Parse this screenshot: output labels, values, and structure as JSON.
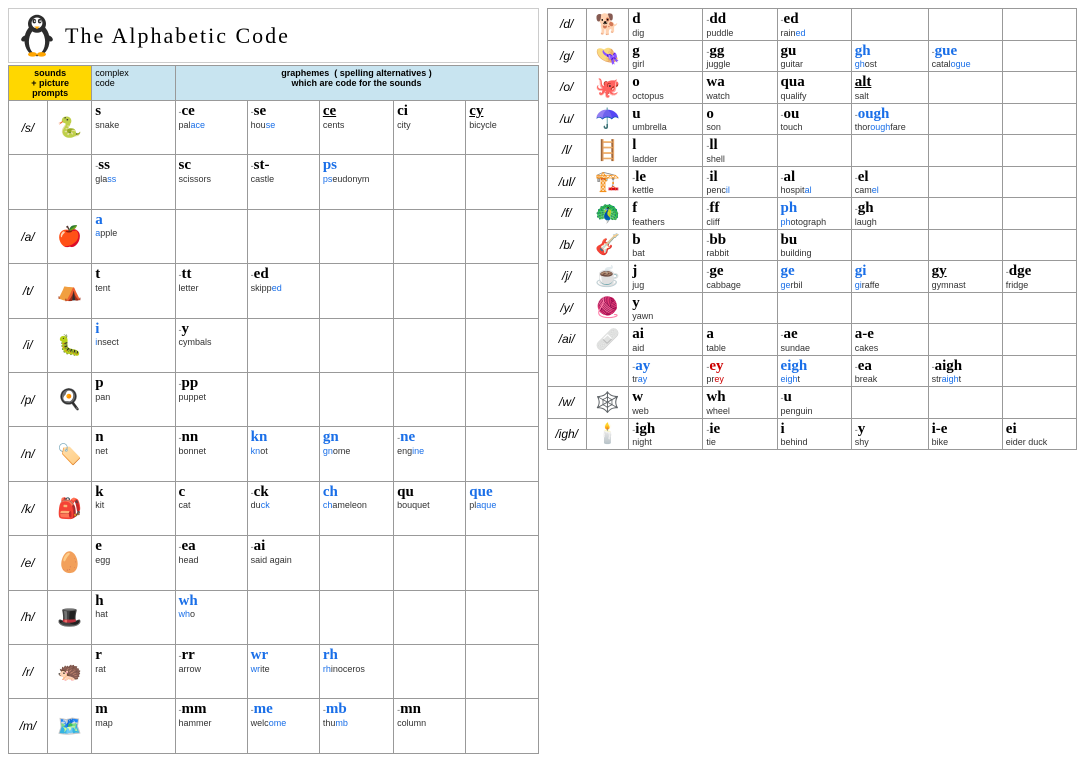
{
  "title": "The Alphabetic Code",
  "header": {
    "col1": "sounds\n+ picture\nprompts",
    "col2": "complex\ncode",
    "col3": "graphemes  ( spelling alternatives )\nwhich are code for the sounds"
  },
  "left_rows": [
    {
      "sound": "/s/",
      "emoji": "🐍",
      "cells": [
        {
          "pre": "",
          "g": "s",
          "word": "snake",
          "hl": ""
        },
        {
          "pre": "-",
          "g": "ce",
          "word": "pal<ace",
          "hl": "ace"
        },
        {
          "pre": "-",
          "g": "se",
          "word": "hou<se",
          "hl": "se"
        },
        {
          "pre": "",
          "g": "ce",
          "word": "cents",
          "hl": "",
          "style": "underline"
        },
        {
          "pre": "",
          "g": "ci",
          "word": "city",
          "hl": ""
        },
        {
          "pre": "",
          "g": "cy",
          "word": "bicycle",
          "hl": "",
          "style": "underline"
        }
      ],
      "row2": [
        {
          "pre": "-",
          "g": "ss",
          "word": "gla<ss",
          "hl": "ss"
        },
        {
          "pre": "",
          "g": "sc",
          "word": "scissors",
          "hl": ""
        },
        {
          "pre": "-",
          "g": "st-",
          "word": "castle",
          "hl": ""
        },
        {
          "pre": "",
          "g": "ps",
          "word": "pseudonym",
          "hl": "ps",
          "blue": true
        }
      ]
    },
    {
      "sound": "/a/",
      "emoji": "🍎",
      "cells": [
        {
          "pre": "",
          "g": "a",
          "word": "apple",
          "hl": "a",
          "blue": true
        }
      ]
    },
    {
      "sound": "/t/",
      "emoji": "⛺",
      "cells": [
        {
          "pre": "",
          "g": "t",
          "word": "tent",
          "hl": ""
        },
        {
          "pre": "-",
          "g": "tt",
          "word": "letter",
          "hl": ""
        },
        {
          "pre": "-",
          "g": "ed",
          "word": "skipp<ed",
          "hl": "ed"
        }
      ]
    },
    {
      "sound": "/i/",
      "emoji": "🐛",
      "cells": [
        {
          "pre": "",
          "g": "i",
          "word": "insect",
          "hl": "i",
          "blue": true
        },
        {
          "pre": "-",
          "g": "y",
          "word": "cymbals",
          "hl": ""
        }
      ]
    },
    {
      "sound": "/p/",
      "emoji": "🍳",
      "cells": [
        {
          "pre": "",
          "g": "p",
          "word": "pan",
          "hl": ""
        },
        {
          "pre": "-",
          "g": "pp",
          "word": "pupp<et",
          "hl": "pp"
        }
      ]
    },
    {
      "sound": "/n/",
      "emoji": "🔖",
      "cells": [
        {
          "pre": "",
          "g": "n",
          "word": "net",
          "hl": ""
        },
        {
          "pre": "-",
          "g": "nn",
          "word": "bonnet",
          "hl": ""
        },
        {
          "pre": "",
          "g": "kn",
          "word": "knot",
          "hl": "kn",
          "blue": true
        },
        {
          "pre": "",
          "g": "gn",
          "word": "gnome",
          "hl": "gn",
          "blue": true
        },
        {
          "pre": "-",
          "g": "ne",
          "word": "eng<ine",
          "hl": "ine",
          "blue": true
        }
      ]
    },
    {
      "sound": "/k/",
      "emoji": "🎒",
      "cells": [
        {
          "pre": "",
          "g": "k",
          "word": "kit",
          "hl": ""
        },
        {
          "pre": "",
          "g": "c",
          "word": "cat",
          "hl": ""
        },
        {
          "pre": "-",
          "g": "ck",
          "word": "du<ck",
          "hl": "ck"
        },
        {
          "pre": "",
          "g": "ch",
          "word": "chameleon",
          "hl": "ch",
          "blue": true
        },
        {
          "pre": "",
          "g": "qu",
          "word": "bouquet",
          "hl": ""
        },
        {
          "pre": "",
          "g": "que",
          "word": "pl<aque",
          "hl": "aque",
          "blue": true
        }
      ]
    },
    {
      "sound": "/e/",
      "emoji": "🥚",
      "cells": [
        {
          "pre": "",
          "g": "e",
          "word": "egg",
          "hl": ""
        },
        {
          "pre": "-",
          "g": "ea",
          "word": "head",
          "hl": ""
        },
        {
          "pre": "-",
          "g": "ai",
          "word": "said again",
          "hl": ""
        }
      ]
    },
    {
      "sound": "/h/",
      "emoji": "🎩",
      "cells": [
        {
          "pre": "",
          "g": "h",
          "word": "hat",
          "hl": ""
        },
        {
          "pre": "",
          "g": "wh",
          "word": "who",
          "hl": "wh",
          "blue": true
        }
      ]
    },
    {
      "sound": "/r/",
      "emoji": "🦔",
      "cells": [
        {
          "pre": "",
          "g": "r",
          "word": "rat",
          "hl": ""
        },
        {
          "pre": "-",
          "g": "rr",
          "word": "arrow",
          "hl": ""
        },
        {
          "pre": "",
          "g": "wr",
          "word": "write",
          "hl": "wr",
          "blue": true
        },
        {
          "pre": "",
          "g": "rh",
          "word": "rhinoceros",
          "hl": "rh",
          "blue": true
        }
      ]
    },
    {
      "sound": "/m/",
      "emoji": "🗺️",
      "cells": [
        {
          "pre": "",
          "g": "m",
          "word": "map",
          "hl": ""
        },
        {
          "pre": "-",
          "g": "mm",
          "word": "hammer",
          "hl": ""
        },
        {
          "pre": "-",
          "g": "me",
          "word": "welc<ome",
          "hl": "ome",
          "blue": true
        },
        {
          "pre": "-",
          "g": "mb",
          "word": "thu<mb",
          "hl": "mb",
          "blue": true
        },
        {
          "pre": "-",
          "g": "mn",
          "word": "column",
          "hl": ""
        }
      ]
    }
  ],
  "right_rows": [
    {
      "sound": "/d/",
      "emoji": "🐕",
      "cells": [
        {
          "pre": "",
          "g": "d",
          "word": "dig",
          "hl": ""
        },
        {
          "pre": "-",
          "g": "dd",
          "word": "puddle",
          "hl": ""
        },
        {
          "pre": "-",
          "g": "ed",
          "word": "rain<ed",
          "hl": "ed"
        }
      ]
    },
    {
      "sound": "/g/",
      "emoji": "👧",
      "cells": [
        {
          "pre": "",
          "g": "g",
          "word": "girl",
          "hl": ""
        },
        {
          "pre": "-",
          "g": "gg",
          "word": "juggle",
          "hl": ""
        },
        {
          "pre": "",
          "g": "gu",
          "word": "guitar",
          "hl": ""
        },
        {
          "pre": "",
          "g": "gh",
          "word": "ghost",
          "hl": "gh",
          "blue": true
        },
        {
          "pre": "-",
          "g": "gue",
          "word": "catal<ogue",
          "hl": "ogue",
          "blue": true
        }
      ]
    },
    {
      "sound": "/o/",
      "emoji": "🐙",
      "cells": [
        {
          "pre": "",
          "g": "o",
          "word": "octopus",
          "hl": ""
        },
        {
          "pre": "",
          "g": "wa",
          "word": "watch",
          "hl": ""
        },
        {
          "pre": "",
          "g": "qua",
          "word": "qualify",
          "hl": ""
        },
        {
          "pre": "",
          "g": "alt",
          "word": "salt",
          "hl": "",
          "style": "underline"
        }
      ]
    },
    {
      "sound": "/u/",
      "emoji": "☂️",
      "cells": [
        {
          "pre": "",
          "g": "u",
          "word": "umbrella",
          "hl": ""
        },
        {
          "pre": "",
          "g": "o",
          "word": "son",
          "hl": ""
        },
        {
          "pre": "-",
          "g": "ou",
          "word": "touch",
          "hl": ""
        },
        {
          "pre": "-",
          "g": "ough",
          "word": "thor<ough>fare",
          "hl": "ough",
          "blue": true
        }
      ]
    },
    {
      "sound": "/l/",
      "emoji": "🪜",
      "cells": [
        {
          "pre": "",
          "g": "l",
          "word": "ladder",
          "hl": ""
        },
        {
          "pre": "-",
          "g": "ll",
          "word": "shell",
          "hl": ""
        }
      ]
    },
    {
      "sound": "/ul/",
      "emoji": "🏗️",
      "cells": [
        {
          "pre": "-",
          "g": "le",
          "word": "kettle",
          "hl": ""
        },
        {
          "pre": "-",
          "g": "il",
          "word": "penc<il",
          "hl": "il"
        },
        {
          "pre": "-",
          "g": "al",
          "word": "hosp<ital",
          "hl": "al"
        },
        {
          "pre": "-",
          "g": "el",
          "word": "cam<el",
          "hl": "el"
        }
      ]
    },
    {
      "sound": "/f/",
      "emoji": "🦚",
      "cells": [
        {
          "pre": "",
          "g": "f",
          "word": "feathers",
          "hl": ""
        },
        {
          "pre": "-",
          "g": "ff",
          "word": "cliff",
          "hl": ""
        },
        {
          "pre": "",
          "g": "ph",
          "word": "photograph",
          "hl": "ph",
          "blue": true
        },
        {
          "pre": "-",
          "g": "gh",
          "word": "laugh",
          "hl": ""
        }
      ]
    },
    {
      "sound": "/b/",
      "emoji": "🎸",
      "cells": [
        {
          "pre": "",
          "g": "b",
          "word": "bat",
          "hl": ""
        },
        {
          "pre": "-",
          "g": "bb",
          "word": "rabbit",
          "hl": ""
        },
        {
          "pre": "",
          "g": "bu",
          "word": "building",
          "hl": ""
        }
      ]
    },
    {
      "sound": "/j/",
      "emoji": "☕",
      "cells": [
        {
          "pre": "",
          "g": "j",
          "word": "jug",
          "hl": ""
        },
        {
          "pre": "-",
          "g": "ge",
          "word": "cabbage",
          "hl": ""
        },
        {
          "pre": "",
          "g": "ge",
          "word": "gerbil",
          "hl": "ge",
          "blue": true,
          "super": true
        },
        {
          "pre": "",
          "g": "gi",
          "word": "giraffe",
          "hl": "gi",
          "blue": true
        },
        {
          "pre": "",
          "g": "gy",
          "word": "gymnast",
          "hl": "",
          "style": "underline"
        },
        {
          "pre": "-",
          "g": "dge",
          "word": "fridge",
          "hl": ""
        }
      ]
    },
    {
      "sound": "/y/",
      "emoji": "🧶",
      "cells": [
        {
          "pre": "",
          "g": "y",
          "word": "yawn",
          "hl": ""
        }
      ]
    },
    {
      "sound": "/ai/",
      "emoji": "🩹",
      "cells": [
        {
          "pre": "",
          "g": "ai",
          "word": "aid",
          "hl": ""
        },
        {
          "pre": "",
          "g": "a",
          "word": "table",
          "hl": ""
        },
        {
          "pre": "-",
          "g": "ae",
          "word": "sundae",
          "hl": ""
        },
        {
          "pre": "",
          "g": "a-e",
          "word": "cakes",
          "hl": ""
        }
      ],
      "row2": [
        {
          "pre": "-",
          "g": "ay",
          "word": "tray",
          "hl": "ay",
          "blue": true
        },
        {
          "pre": "-",
          "g": "ey",
          "word": "prey",
          "hl": "ey",
          "red": true
        },
        {
          "pre": "",
          "g": "eigh",
          "word": "eight",
          "hl": "eigh",
          "blue": true
        },
        {
          "pre": "-",
          "g": "ea",
          "word": "break",
          "hl": ""
        },
        {
          "pre": "-",
          "g": "aigh",
          "word": "str<aight",
          "hl": "aigh"
        }
      ]
    },
    {
      "sound": "/w/",
      "emoji": "🕸️",
      "cells": [
        {
          "pre": "",
          "g": "w",
          "word": "web",
          "hl": ""
        },
        {
          "pre": "",
          "g": "wh",
          "word": "wheel",
          "hl": ""
        },
        {
          "pre": "-",
          "g": "u",
          "word": "penguin",
          "hl": ""
        }
      ]
    },
    {
      "sound": "/igh/",
      "emoji": "🕯️",
      "cells": [
        {
          "pre": "-",
          "g": "igh",
          "word": "night",
          "hl": ""
        },
        {
          "pre": "-",
          "g": "ie",
          "word": "tie",
          "hl": ""
        },
        {
          "pre": "",
          "g": "i",
          "word": "behind",
          "hl": ""
        },
        {
          "pre": "-",
          "g": "y",
          "word": "shy",
          "hl": ""
        },
        {
          "pre": "",
          "g": "i-e",
          "word": "bike",
          "hl": ""
        },
        {
          "pre": "",
          "g": "ei",
          "word": "eider duck",
          "hl": ""
        }
      ]
    }
  ]
}
